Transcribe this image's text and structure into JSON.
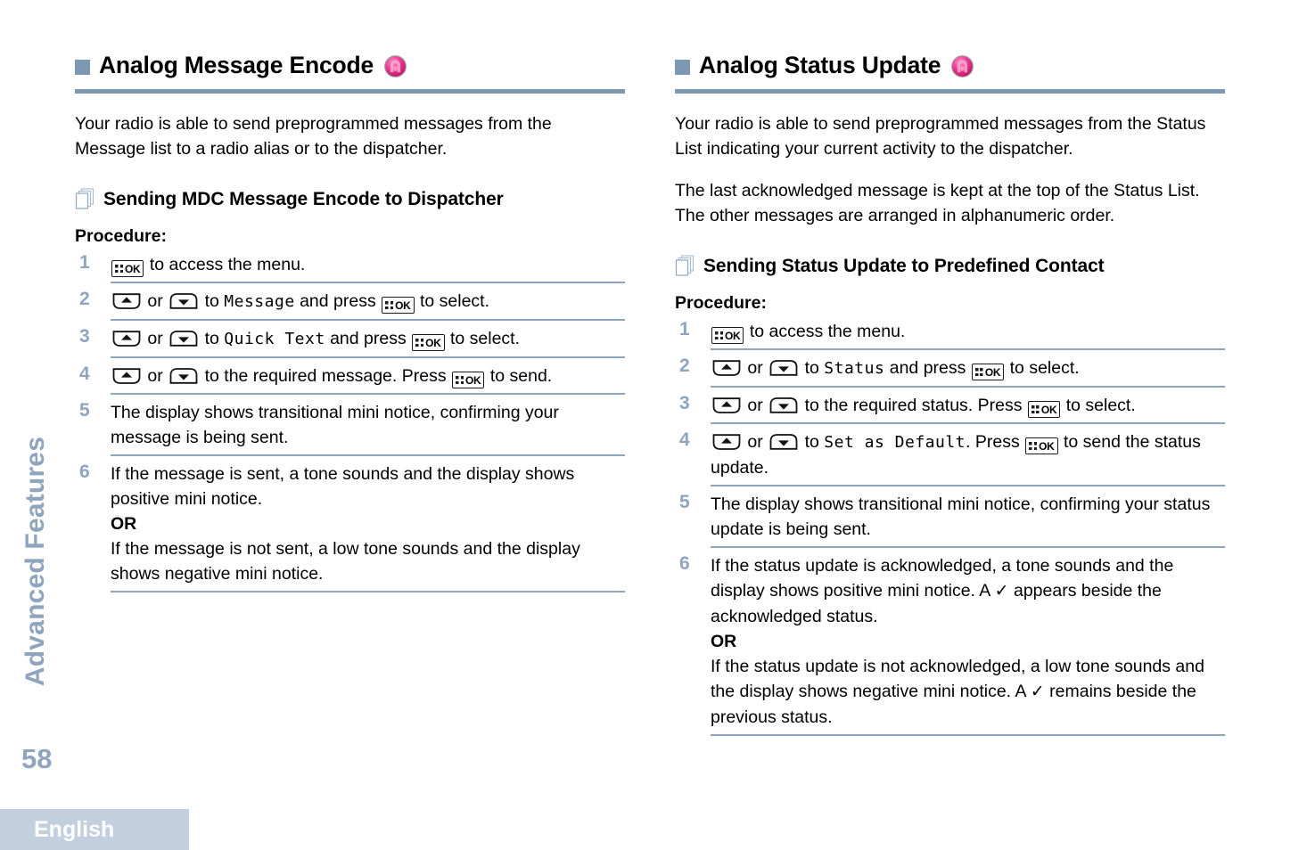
{
  "rail": {
    "chapter": "Advanced Features",
    "page_number": "58",
    "language": "English"
  },
  "colors": {
    "accent_blue": "#7E97B3",
    "rail_blue": "#8EA5BD",
    "badge_blue": "#C2CFDE",
    "lock_pink": "#E8308A"
  },
  "left_column": {
    "heading": "Analog Message Encode",
    "heading_icon": "analog-lock-icon",
    "intro": "Your radio is able to send preprogrammed messages from the Message list to a radio alias or to the dispatcher.",
    "subheading": "Sending MDC Message Encode to Dispatcher",
    "subheading_icon": "stacked-pages-icon",
    "procedure_label": "Procedure:",
    "steps": [
      {
        "num": "1",
        "parts": [
          {
            "type": "key-ok",
            "label": "OK"
          },
          {
            "type": "text",
            "text": " to access the menu."
          }
        ]
      },
      {
        "num": "2",
        "parts": [
          {
            "type": "key-up"
          },
          {
            "type": "text",
            "text": " or "
          },
          {
            "type": "key-down"
          },
          {
            "type": "text",
            "text": " to "
          },
          {
            "type": "lcd",
            "text": "Message"
          },
          {
            "type": "text",
            "text": " and press "
          },
          {
            "type": "key-ok",
            "label": "OK"
          },
          {
            "type": "text",
            "text": " to select."
          }
        ]
      },
      {
        "num": "3",
        "parts": [
          {
            "type": "key-up"
          },
          {
            "type": "text",
            "text": " or "
          },
          {
            "type": "key-down"
          },
          {
            "type": "text",
            "text": " to "
          },
          {
            "type": "lcd",
            "text": "Quick Text"
          },
          {
            "type": "text",
            "text": " and press "
          },
          {
            "type": "key-ok",
            "label": "OK"
          },
          {
            "type": "text",
            "text": " to select."
          }
        ]
      },
      {
        "num": "4",
        "parts": [
          {
            "type": "key-up"
          },
          {
            "type": "text",
            "text": " or "
          },
          {
            "type": "key-down"
          },
          {
            "type": "text",
            "text": " to the required message. Press "
          },
          {
            "type": "key-ok",
            "label": "OK"
          },
          {
            "type": "text",
            "text": " to send."
          }
        ]
      },
      {
        "num": "5",
        "parts": [
          {
            "type": "text",
            "text": " The display shows transitional mini notice, confirming your message is being sent."
          }
        ]
      },
      {
        "num": "6",
        "parts": [
          {
            "type": "text",
            "text": "If the message is sent, a tone sounds and the display shows positive mini notice."
          },
          {
            "type": "br"
          },
          {
            "type": "bold",
            "text": "OR"
          },
          {
            "type": "br"
          },
          {
            "type": "text",
            "text": "If the message is not sent, a low tone sounds and the display shows negative mini notice."
          }
        ]
      }
    ]
  },
  "right_column": {
    "heading": "Analog Status Update",
    "heading_icon": "analog-lock-icon",
    "intro": "Your radio is able to send preprogrammed messages from the Status List indicating your current activity to the dispatcher.",
    "intro2": "The last acknowledged message is kept at the top of the Status List. The other messages are arranged in alphanumeric order.",
    "subheading": "Sending Status Update to Predefined Contact",
    "subheading_icon": "stacked-pages-icon",
    "procedure_label": "Procedure:",
    "steps": [
      {
        "num": "1",
        "parts": [
          {
            "type": "key-ok",
            "label": "OK"
          },
          {
            "type": "text",
            "text": " to access the menu."
          }
        ]
      },
      {
        "num": "2",
        "parts": [
          {
            "type": "key-up"
          },
          {
            "type": "text",
            "text": " or "
          },
          {
            "type": "key-down"
          },
          {
            "type": "text",
            "text": " to "
          },
          {
            "type": "lcd",
            "text": "Status"
          },
          {
            "type": "text",
            "text": " and press "
          },
          {
            "type": "key-ok",
            "label": "OK"
          },
          {
            "type": "text",
            "text": " to select."
          }
        ]
      },
      {
        "num": "3",
        "parts": [
          {
            "type": "key-up"
          },
          {
            "type": "text",
            "text": " or "
          },
          {
            "type": "key-down"
          },
          {
            "type": "text",
            "text": " to the required status. Press "
          },
          {
            "type": "key-ok",
            "label": "OK"
          },
          {
            "type": "text",
            "text": " to select."
          }
        ]
      },
      {
        "num": "4",
        "parts": [
          {
            "type": "key-up"
          },
          {
            "type": "text",
            "text": " or "
          },
          {
            "type": "key-down"
          },
          {
            "type": "text",
            "text": " to "
          },
          {
            "type": "lcd",
            "text": "Set as Default"
          },
          {
            "type": "text",
            "text": ". Press "
          },
          {
            "type": "key-ok",
            "label": "OK"
          },
          {
            "type": "text",
            "text": " to send the status update."
          }
        ]
      },
      {
        "num": "5",
        "parts": [
          {
            "type": "text",
            "text": "The display shows transitional mini notice, confirming your status update is being sent."
          }
        ]
      },
      {
        "num": "6",
        "parts": [
          {
            "type": "text",
            "text": "If the status update is acknowledged, a tone sounds and the display shows positive mini notice. A "
          },
          {
            "type": "check",
            "text": "✓"
          },
          {
            "type": "text",
            "text": " appears beside the acknowledged status."
          },
          {
            "type": "br"
          },
          {
            "type": "bold",
            "text": "OR"
          },
          {
            "type": "br"
          },
          {
            "type": "text",
            "text": "If the status update is not acknowledged, a low tone sounds and the display shows negative mini notice. A "
          },
          {
            "type": "check",
            "text": "✓"
          },
          {
            "type": "text",
            "text": " remains beside the previous status."
          }
        ]
      }
    ]
  }
}
